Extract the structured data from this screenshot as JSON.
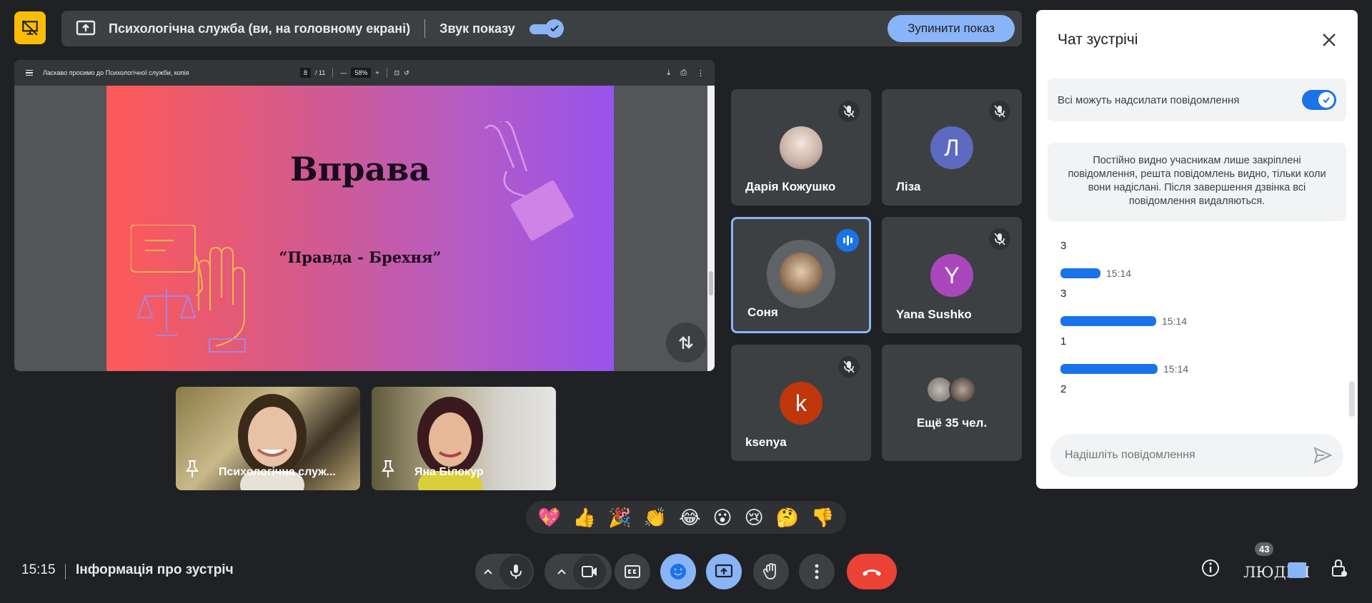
{
  "topbar": {
    "presenting_title": "Психологічна служба (ви, на головному екрані)",
    "sound_label": "Звук показу",
    "stop_button": "Зупинити показ"
  },
  "presentation": {
    "doc_title": "Ласкаво просимо до Психологічної служби, копія",
    "page_current": "8",
    "page_total": "/ 11",
    "zoom": "58%",
    "slide_title": "Вправа",
    "slide_subtitle": "“Правда - Брехня”"
  },
  "pinned": [
    {
      "name": "Психологічна служ..."
    },
    {
      "name": "Яна Білокур"
    }
  ],
  "participants": [
    {
      "name": "Дарія Кожушко",
      "initial": ""
    },
    {
      "name": "Ліза",
      "initial": "Л",
      "color": "#5c6bc0"
    },
    {
      "name": "Соня",
      "initial": ""
    },
    {
      "name": "Yana Sushko",
      "initial": "Y",
      "color": "#ab47bc"
    },
    {
      "name": "ksenya",
      "initial": "k",
      "color": "#bf360c"
    },
    {
      "name": "Ещё 35 чел.",
      "initial": ""
    }
  ],
  "chat": {
    "title": "Чат зустрічі",
    "permission_label": "Всі можуть надсилати повідомлення",
    "notice": "Постійно видно учасникам лише закріплені повідомлення, решта повідомлень видно, тільки коли вони надіслані. Після завершення дзвінка всі повідомлення видаляються.",
    "first_message": "3",
    "messages": [
      {
        "time": "15:14",
        "text": "3"
      },
      {
        "time": "15:14",
        "text": "1"
      },
      {
        "time": "15:14",
        "text": "2"
      }
    ],
    "input_placeholder": "Надішліть повідомлення"
  },
  "reactions": [
    "💖",
    "👍",
    "🎉",
    "👏",
    "😂",
    "😮",
    "😢",
    "🤔",
    "👎"
  ],
  "bottom": {
    "time": "15:15",
    "meeting_info": "Інформація про зустріч",
    "people_label": "ЛЮДЕЙ",
    "people_count": "43"
  },
  "colors": {
    "accent": "#8ab4f8",
    "end_call": "#ea4335",
    "present_icon_bg": "#fbbc04",
    "speaking": "#1a73e8"
  }
}
